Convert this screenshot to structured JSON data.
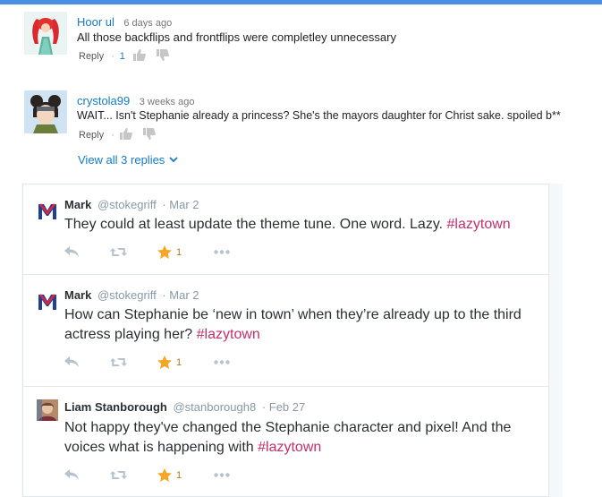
{
  "colors": {
    "accent": "#167ac6",
    "hashtag": "#c0306a",
    "star": "#f5a623",
    "topbar": "#4a90e2"
  },
  "youtube_comments": [
    {
      "author": "Hoor ul",
      "time": "6 days ago",
      "text": "All those backflips and frontflips were completley unnecessary",
      "reply_label": "Reply",
      "like_count": "1"
    },
    {
      "author": "crystola99",
      "time": "3 weeks ago",
      "text": "WAIT... Isn't Stephanie already a princess? She's the mayors daughter for Christ sake. spoiled b**",
      "reply_label": "Reply",
      "like_count": ""
    }
  ],
  "view_replies_label": "View all 3 replies",
  "tweets": [
    {
      "name": "Mark",
      "handle": "@stokegriff",
      "date": "· Mar 2",
      "text_lines": [
        "They could at least update the theme tune. One word. Lazy. "
      ],
      "hashtag": "#lazytown",
      "fav_count": "1"
    },
    {
      "name": "Mark",
      "handle": "@stokegriff",
      "date": "· Mar 2",
      "text_lines": [
        "How can Stephanie be ‘new in town’ when they’re already up to the third",
        "actress playing her? "
      ],
      "hashtag": "#lazytown",
      "fav_count": "1"
    },
    {
      "name": "Liam Stanborough",
      "handle": "@stanborough8",
      "date": "· Feb 27",
      "text_lines": [
        "Not happy they've changed the Stephanie character and pixel! And the",
        "voices what is happening with "
      ],
      "hashtag": "#lazytown",
      "fav_count": "1"
    }
  ]
}
